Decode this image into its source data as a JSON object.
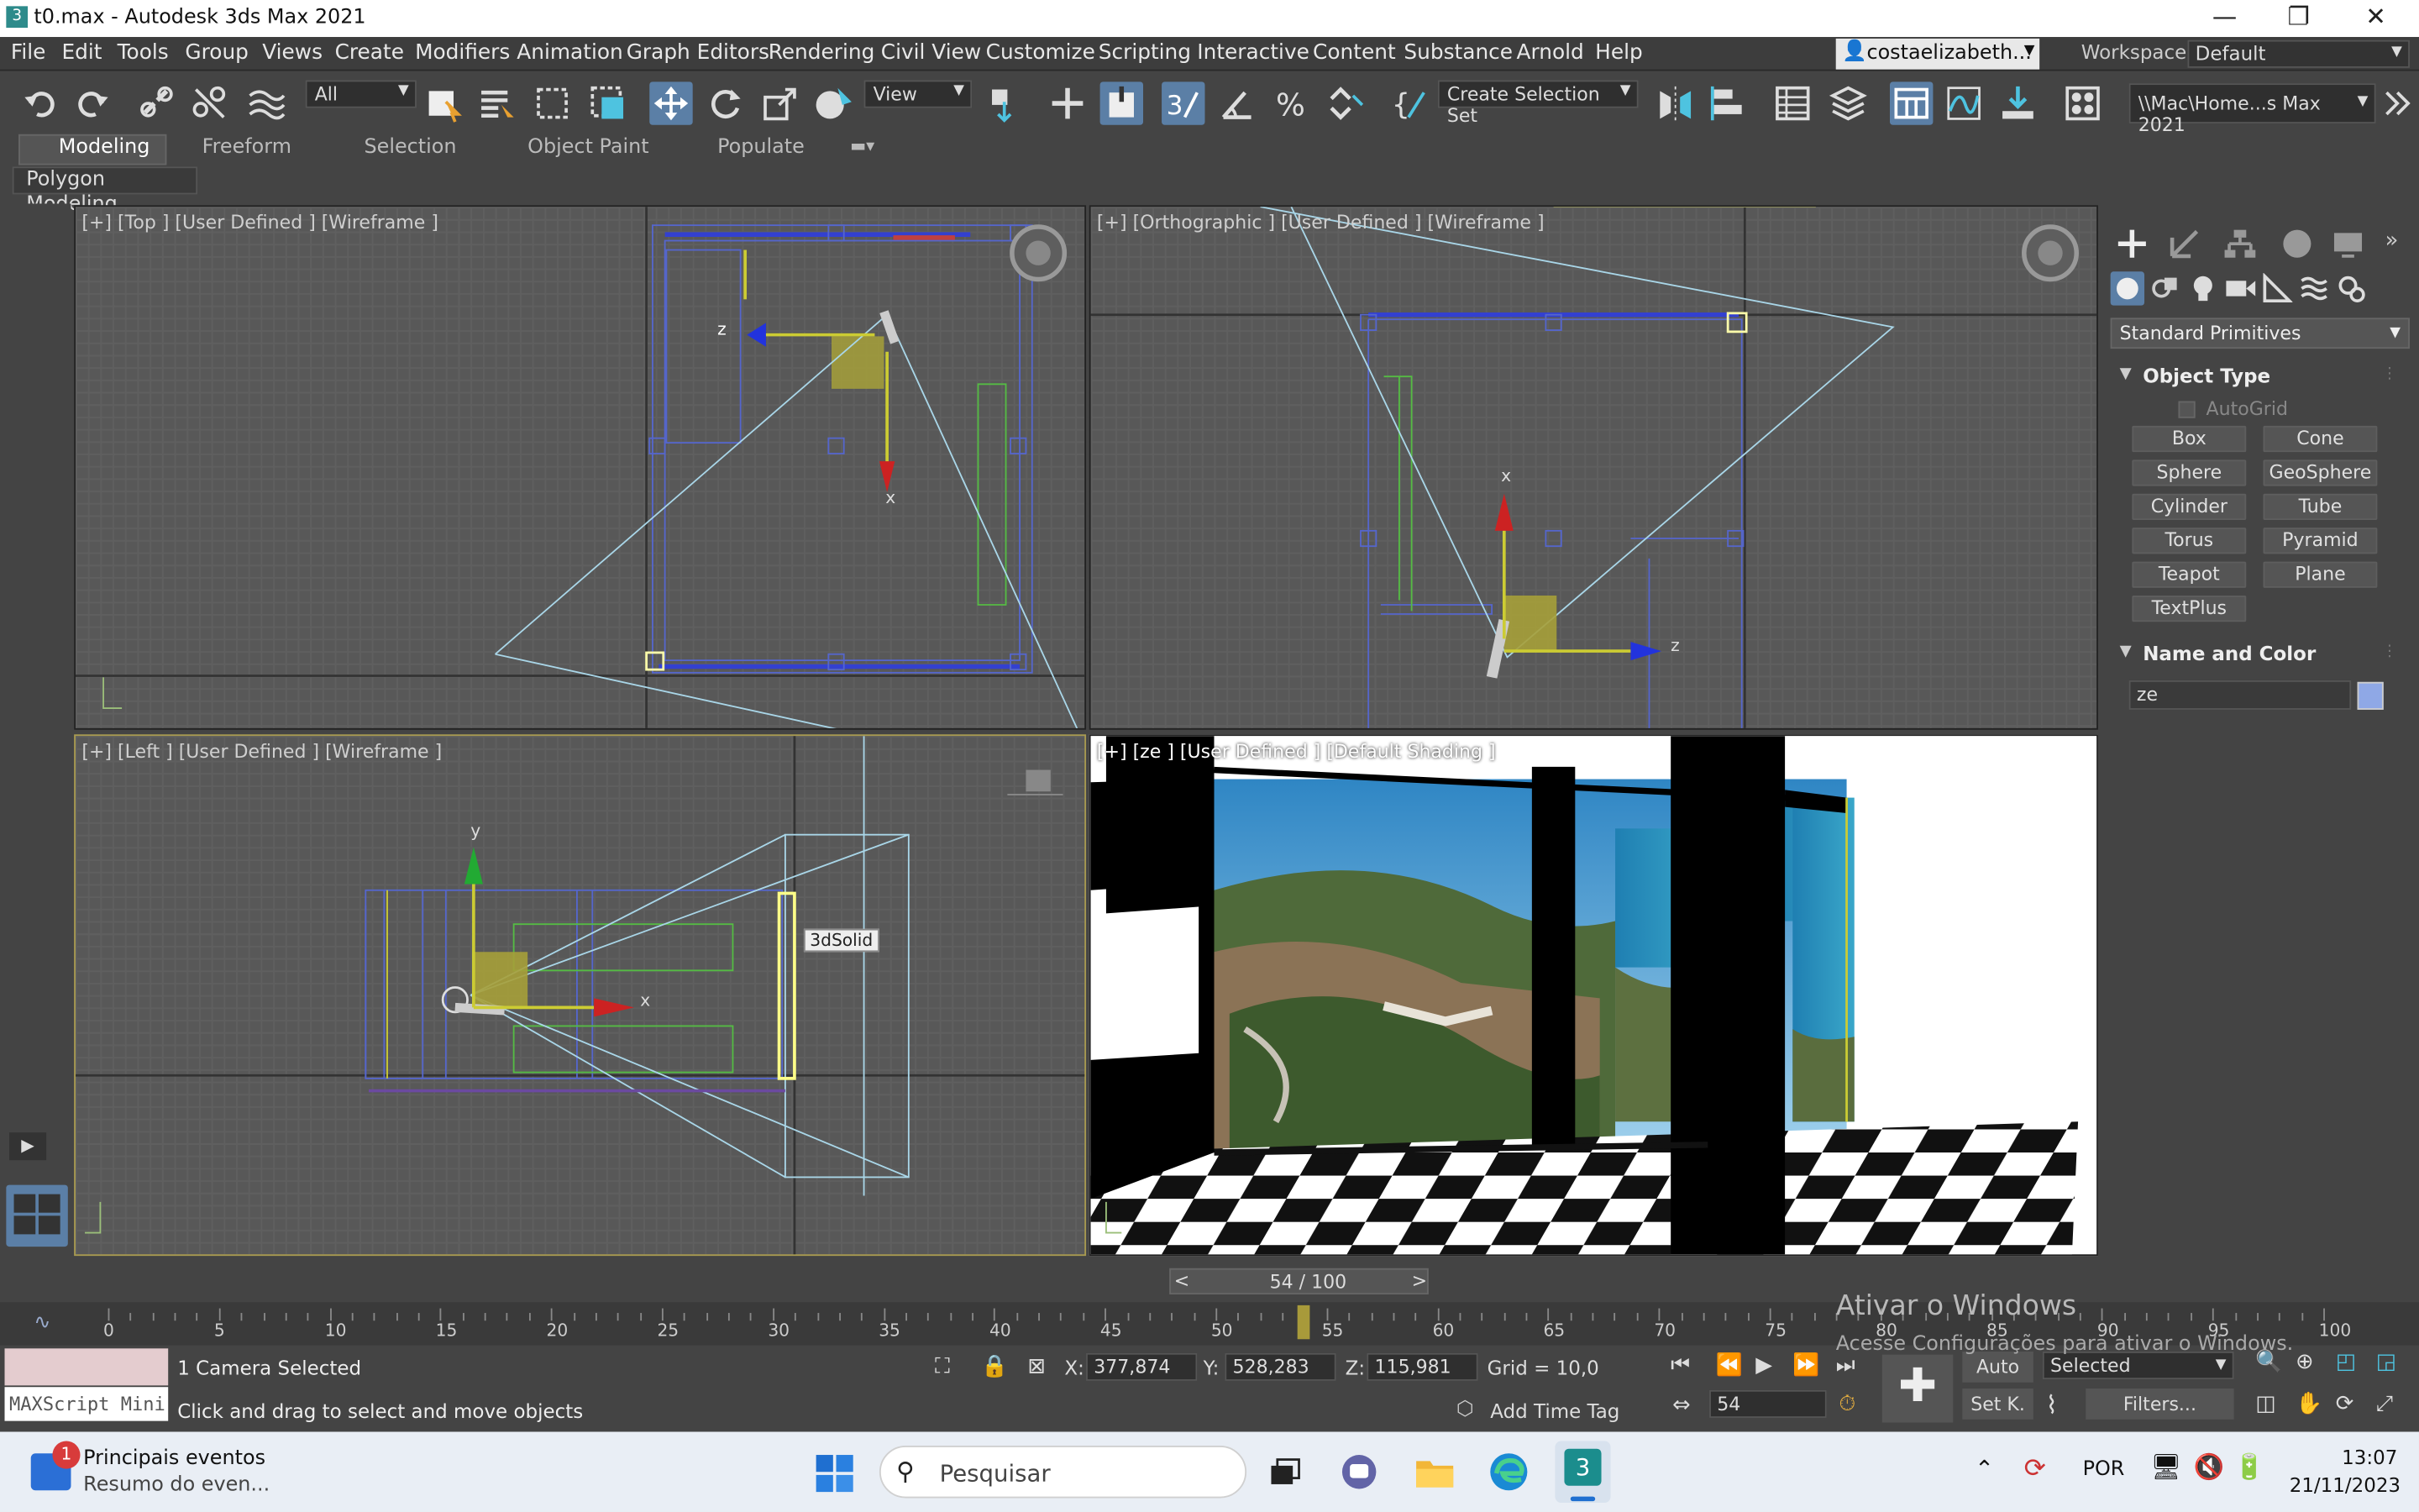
{
  "window": {
    "title": "t0.max - Autodesk 3ds Max 2021",
    "minimize": "—",
    "restore": "❐",
    "close": "✕"
  },
  "menu": [
    "File",
    "Edit",
    "Tools",
    "Group",
    "Views",
    "Create",
    "Modifiers",
    "Animation",
    "Graph Editors",
    "Rendering",
    "Civil View",
    "Customize",
    "Scripting",
    "Interactive",
    "Content",
    "Substance",
    "Arnold",
    "Help"
  ],
  "user": {
    "name": "costaelizabeth...",
    "workspaces_label": "Workspaces:",
    "workspace_value": "Default"
  },
  "toolbar": {
    "filter_value": "All",
    "refcoord_value": "View",
    "selection_set_value": "Create Selection Set",
    "project_path": "\\\\Mac\\Home...s Max 2021"
  },
  "ribbon": {
    "tabs": [
      "Modeling",
      "Freeform",
      "Selection",
      "Object Paint",
      "Populate"
    ],
    "active": "Modeling",
    "panel": "Polygon Modeling"
  },
  "viewports": {
    "top": {
      "label": "[+] [Top ] [User Defined ] [Wireframe ]"
    },
    "ortho": {
      "label": "[+] [Orthographic ] [User Defined ] [Wireframe ]"
    },
    "left": {
      "label": "[+] [Left ] [User Defined ] [Wireframe ]",
      "tooltip": "3dSolid"
    },
    "camera": {
      "label": "[+] [ze ] [User Defined ] [Default Shading ]"
    }
  },
  "axes": {
    "x": "x",
    "y": "y",
    "z": "z"
  },
  "command_panel": {
    "category_value": "Standard Primitives",
    "object_type_title": "Object Type",
    "autogrid_label": "AutoGrid",
    "buttons": [
      "Box",
      "Cone",
      "Sphere",
      "GeoSphere",
      "Cylinder",
      "Tube",
      "Torus",
      "Pyramid",
      "Teapot",
      "Plane",
      "TextPlus"
    ],
    "name_color_title": "Name and Color",
    "name_value": "ze",
    "color": "#8fa8e6"
  },
  "timeline": {
    "frame_display": "54 / 100",
    "prev": "<",
    "next": ">",
    "ticks": [
      "0",
      "5",
      "10",
      "15",
      "20",
      "25",
      "30",
      "35",
      "40",
      "45",
      "50",
      "55",
      "60",
      "65",
      "70",
      "75",
      "80",
      "85",
      "90",
      "95",
      "100"
    ],
    "current_frame": 54
  },
  "status": {
    "maxscript_label": "MAXScript Mini",
    "selection_text": "1 Camera Selected",
    "prompt_text": "Click and drag to select and move objects",
    "x_label": "X:",
    "x_value": "377,874",
    "y_label": "Y:",
    "y_value": "528,283",
    "z_label": "Z:",
    "z_value": "115,981",
    "grid_text": "Grid = 10,0",
    "add_time_tag": "Add Time Tag",
    "auto_label": "Auto",
    "setkey_label": "Set K.",
    "key_filter_value": "Selected",
    "filters_label": "Filters...",
    "frame_value": "54"
  },
  "watermark": {
    "line1": "Ativar o Windows",
    "line2": "Acesse Configurações para ativar o Windows."
  },
  "taskbar": {
    "news_title": "Principais eventos",
    "news_sub": "Resumo do even...",
    "news_badge": "1",
    "search_placeholder": "Pesquisar",
    "lang": "POR",
    "time": "13:07",
    "date": "21/11/2023"
  }
}
